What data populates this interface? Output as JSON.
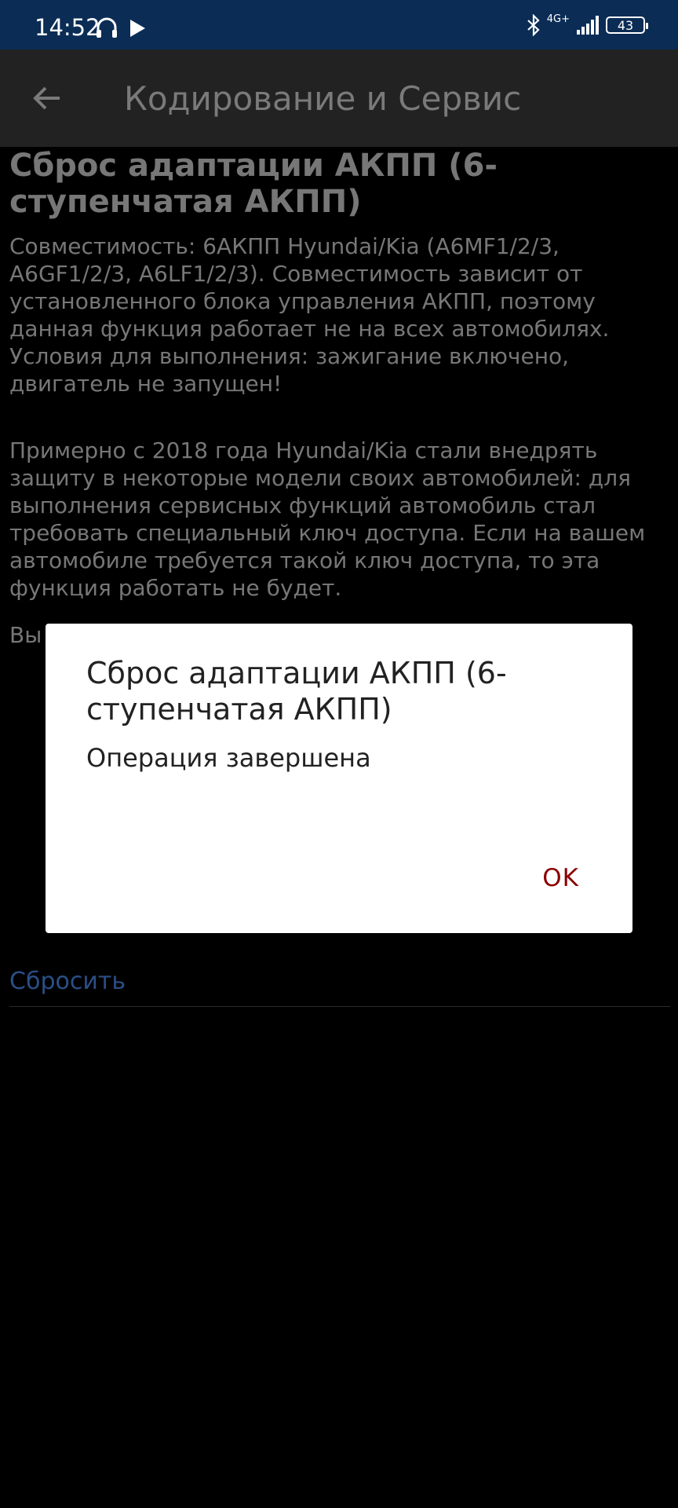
{
  "status_bar": {
    "time": "14:52",
    "network": "4G+",
    "battery": "43",
    "icons": [
      "headset-icon",
      "play-icon",
      "bluetooth-icon",
      "signal-icon",
      "battery-icon"
    ]
  },
  "app_bar": {
    "title": "Кодирование и Сервис",
    "back_icon": "arrow-left-icon"
  },
  "content": {
    "heading": "Сброс адаптации АКПП (6-ступенчатая АКПП)",
    "paragraph1": "Совместимость: 6АКПП Hyundai/Kia (A6MF1/2/3, A6GF1/2/3, A6LF1/2/3). Совместимость зависит от установленного блока управления АКПП, поэтому данная функция работает не на всех автомобилях. Условия для выполнения: зажигание включено, двигатель не запущен!",
    "paragraph2": "Примерно с 2018 года Hyundai/Kia стали внедрять защиту в некоторые модели своих автомобилей: для выполнения сервисных функций автомобиль стал требовать специальный ключ доступа. Если на вашем автомобиле требуется такой ключ доступа, то эта функция работать не будет.",
    "partial_text": "Вы",
    "reset_label": "Сбросить"
  },
  "dialog": {
    "title": "Сброс адаптации АКПП (6-ступенчатая АКПП)",
    "message": "Операция завершена",
    "ok_label": "OK"
  },
  "colors": {
    "status_bar": "#0a2c55",
    "app_bar": "#222222",
    "link": "#2a4f86",
    "ok_button": "#8b0000"
  }
}
